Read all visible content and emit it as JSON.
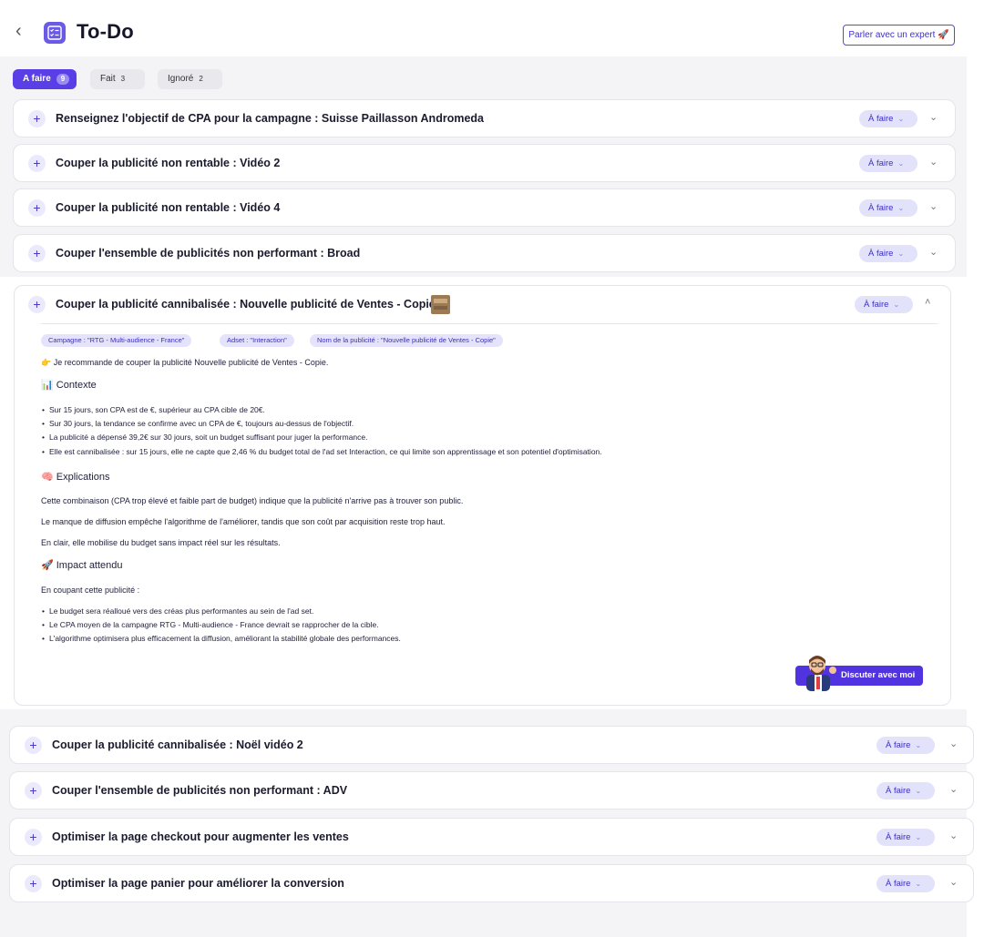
{
  "header": {
    "back_icon": "chevron-left-icon",
    "app_icon": "checklist-icon",
    "title": "To-Do",
    "expert_button": "Parler avec un expert 🚀"
  },
  "tabs": [
    {
      "label": "A faire",
      "count": "9"
    },
    {
      "label": "Fait",
      "count": "3"
    },
    {
      "label": "Ignoré",
      "count": "2"
    }
  ],
  "status_label": "À faire",
  "tasks": [
    {
      "title": "Renseignez l'objectif de CPA pour la campagne : Suisse Paillasson Andromeda"
    },
    {
      "title": "Couper la publicité non rentable : Vidéo 2"
    },
    {
      "title": "Couper la publicité non rentable : Vidéo 4"
    },
    {
      "title": "Couper l'ensemble de publicités non performant : Broad"
    },
    {
      "title": "Couper la publicité cannibalisée : Nouvelle publicité de Ventes - Copie"
    },
    {
      "title": "Couper la publicité cannibalisée : Noël vidéo 2"
    },
    {
      "title": "Couper l'ensemble de publicités non performant : ADV"
    },
    {
      "title": "Optimiser la page checkout pour augmenter les ventes"
    },
    {
      "title": "Optimiser la page panier pour améliorer la conversion"
    }
  ],
  "expanded": {
    "chips": [
      "Campagne : \"RTG - Multi-audience - France\"",
      "Adset : \"Interaction\"",
      "Nom de la publicité : \"Nouvelle publicité de Ventes - Copie\""
    ],
    "recommendation": "👉 Je recommande de couper la publicité Nouvelle publicité de Ventes - Copie.",
    "contexte_title": "📊 Contexte",
    "contexte_bullets": [
      "Sur 15 jours, son CPA est de €, supérieur au CPA cible de 20€.",
      "Sur 30 jours, la tendance se confirme avec un CPA de €, toujours au-dessus de l'objectif.",
      "La publicité a dépensé 39,2€ sur 30 jours, soit un budget suffisant pour juger la performance.",
      "Elle est cannibalisée : sur 15 jours, elle ne capte que 2,46 % du budget total de l'ad set Interaction, ce qui limite son apprentissage et son potentiel d'optimisation."
    ],
    "explications_title": "🧠 Explications",
    "explications_paragraphs": [
      "Cette combinaison (CPA trop élevé et faible part de budget) indique que la publicité n'arrive pas à trouver son public.",
      "Le manque de diffusion empêche l'algorithme de l'améliorer, tandis que son coût par acquisition reste trop haut.",
      "En clair, elle mobilise du budget sans impact réel sur les résultats."
    ],
    "impact_title": "🚀 Impact attendu",
    "impact_intro": "En coupant cette publicité :",
    "impact_bullets": [
      "Le budget sera réalloué vers des créas plus performantes au sein de l'ad set.",
      "Le CPA moyen de la campagne RTG - Multi-audience - France devrait se rapprocher de la cible.",
      "L'algorithme optimisera plus efficacement la diffusion, améliorant la stabilité globale des performances."
    ],
    "discuss_button": "Discuter avec moi"
  }
}
